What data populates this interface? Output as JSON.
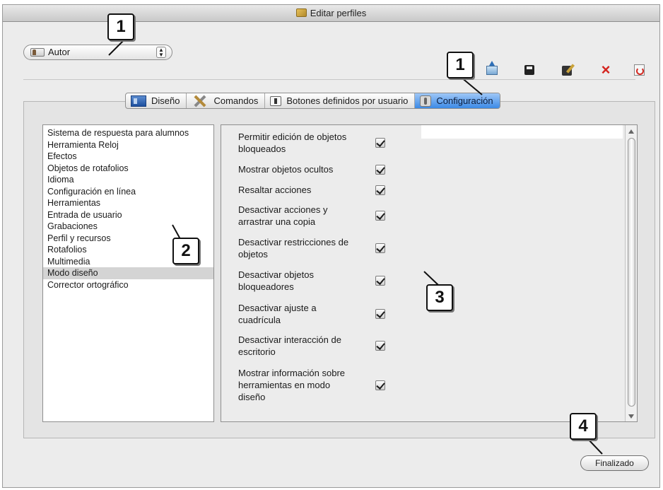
{
  "window": {
    "title": "Editar perfiles"
  },
  "profile": {
    "selected": "Autor"
  },
  "toolbar": {
    "icons": [
      "export-profile-icon",
      "save-icon",
      "save-as-icon",
      "delete-icon",
      "reset-icon"
    ],
    "delete_glyph": "×"
  },
  "tabs": [
    {
      "label": "Diseño",
      "icon": "design-icon"
    },
    {
      "label": "Comandos",
      "icon": "tools-icon"
    },
    {
      "label": "Botones definidos por usuario",
      "icon": "user-buttons-icon"
    },
    {
      "label": "Configuración",
      "icon": "settings-icon",
      "active": true
    }
  ],
  "categories": [
    "Sistema de respuesta para alumnos",
    "Herramienta Reloj",
    "Efectos",
    "Objetos de rotafolios",
    "Idioma",
    "Configuración en línea",
    "Herramientas",
    "Entrada de usuario",
    "Grabaciones",
    "Perfil y recursos",
    "Rotafolios",
    "Multimedia",
    "Modo diseño",
    "Corrector ortográfico"
  ],
  "selected_category": "Modo diseño",
  "settings": [
    {
      "label": "Permitir edición de objetos bloqueados",
      "checked": true
    },
    {
      "label": "Mostrar objetos ocultos",
      "checked": true
    },
    {
      "label": "Resaltar acciones",
      "checked": true
    },
    {
      "label": "Desactivar acciones y arrastrar una copia",
      "checked": true
    },
    {
      "label": "Desactivar restricciones de objetos",
      "checked": true
    },
    {
      "label": "Desactivar objetos bloqueadores",
      "checked": true
    },
    {
      "label": "Desactivar ajuste a cuadrícula",
      "checked": true
    },
    {
      "label": "Desactivar interacción de escritorio",
      "checked": true
    },
    {
      "label": "Mostrar información sobre herramientas en modo diseño",
      "checked": true
    }
  ],
  "done_button": "Finalizado",
  "callouts": {
    "profile": "1",
    "config_tab": "1",
    "categories": "2",
    "settings": "3",
    "done": "4"
  },
  "scroll": {
    "up_icon": "scroll-up-arrow-icon",
    "down_icon": "scroll-down-arrow-icon"
  }
}
